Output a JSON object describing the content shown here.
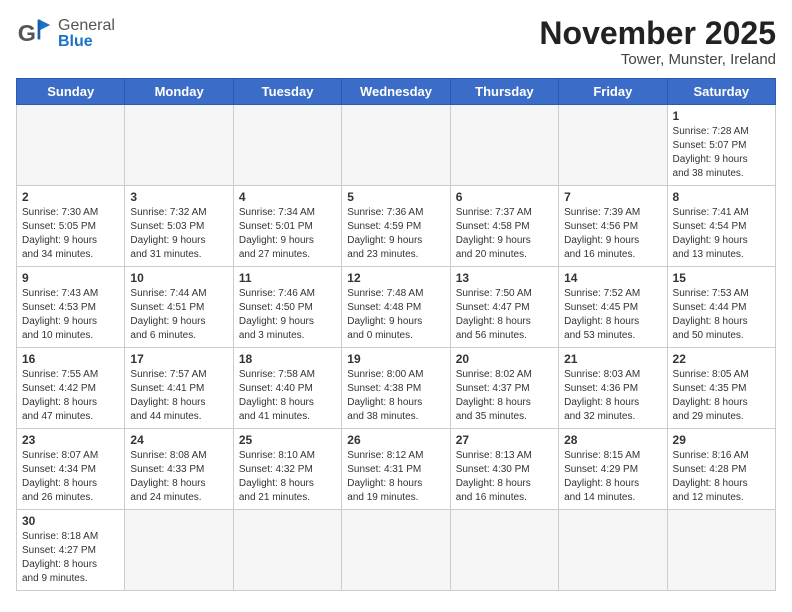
{
  "header": {
    "logo_text_general": "General",
    "logo_text_blue": "Blue",
    "title": "November 2025",
    "subtitle": "Tower, Munster, Ireland"
  },
  "weekdays": [
    "Sunday",
    "Monday",
    "Tuesday",
    "Wednesday",
    "Thursday",
    "Friday",
    "Saturday"
  ],
  "weeks": [
    [
      {
        "day": "",
        "info": ""
      },
      {
        "day": "",
        "info": ""
      },
      {
        "day": "",
        "info": ""
      },
      {
        "day": "",
        "info": ""
      },
      {
        "day": "",
        "info": ""
      },
      {
        "day": "",
        "info": ""
      },
      {
        "day": "1",
        "info": "Sunrise: 7:28 AM\nSunset: 5:07 PM\nDaylight: 9 hours\nand 38 minutes."
      }
    ],
    [
      {
        "day": "2",
        "info": "Sunrise: 7:30 AM\nSunset: 5:05 PM\nDaylight: 9 hours\nand 34 minutes."
      },
      {
        "day": "3",
        "info": "Sunrise: 7:32 AM\nSunset: 5:03 PM\nDaylight: 9 hours\nand 31 minutes."
      },
      {
        "day": "4",
        "info": "Sunrise: 7:34 AM\nSunset: 5:01 PM\nDaylight: 9 hours\nand 27 minutes."
      },
      {
        "day": "5",
        "info": "Sunrise: 7:36 AM\nSunset: 4:59 PM\nDaylight: 9 hours\nand 23 minutes."
      },
      {
        "day": "6",
        "info": "Sunrise: 7:37 AM\nSunset: 4:58 PM\nDaylight: 9 hours\nand 20 minutes."
      },
      {
        "day": "7",
        "info": "Sunrise: 7:39 AM\nSunset: 4:56 PM\nDaylight: 9 hours\nand 16 minutes."
      },
      {
        "day": "8",
        "info": "Sunrise: 7:41 AM\nSunset: 4:54 PM\nDaylight: 9 hours\nand 13 minutes."
      }
    ],
    [
      {
        "day": "9",
        "info": "Sunrise: 7:43 AM\nSunset: 4:53 PM\nDaylight: 9 hours\nand 10 minutes."
      },
      {
        "day": "10",
        "info": "Sunrise: 7:44 AM\nSunset: 4:51 PM\nDaylight: 9 hours\nand 6 minutes."
      },
      {
        "day": "11",
        "info": "Sunrise: 7:46 AM\nSunset: 4:50 PM\nDaylight: 9 hours\nand 3 minutes."
      },
      {
        "day": "12",
        "info": "Sunrise: 7:48 AM\nSunset: 4:48 PM\nDaylight: 9 hours\nand 0 minutes."
      },
      {
        "day": "13",
        "info": "Sunrise: 7:50 AM\nSunset: 4:47 PM\nDaylight: 8 hours\nand 56 minutes."
      },
      {
        "day": "14",
        "info": "Sunrise: 7:52 AM\nSunset: 4:45 PM\nDaylight: 8 hours\nand 53 minutes."
      },
      {
        "day": "15",
        "info": "Sunrise: 7:53 AM\nSunset: 4:44 PM\nDaylight: 8 hours\nand 50 minutes."
      }
    ],
    [
      {
        "day": "16",
        "info": "Sunrise: 7:55 AM\nSunset: 4:42 PM\nDaylight: 8 hours\nand 47 minutes."
      },
      {
        "day": "17",
        "info": "Sunrise: 7:57 AM\nSunset: 4:41 PM\nDaylight: 8 hours\nand 44 minutes."
      },
      {
        "day": "18",
        "info": "Sunrise: 7:58 AM\nSunset: 4:40 PM\nDaylight: 8 hours\nand 41 minutes."
      },
      {
        "day": "19",
        "info": "Sunrise: 8:00 AM\nSunset: 4:38 PM\nDaylight: 8 hours\nand 38 minutes."
      },
      {
        "day": "20",
        "info": "Sunrise: 8:02 AM\nSunset: 4:37 PM\nDaylight: 8 hours\nand 35 minutes."
      },
      {
        "day": "21",
        "info": "Sunrise: 8:03 AM\nSunset: 4:36 PM\nDaylight: 8 hours\nand 32 minutes."
      },
      {
        "day": "22",
        "info": "Sunrise: 8:05 AM\nSunset: 4:35 PM\nDaylight: 8 hours\nand 29 minutes."
      }
    ],
    [
      {
        "day": "23",
        "info": "Sunrise: 8:07 AM\nSunset: 4:34 PM\nDaylight: 8 hours\nand 26 minutes."
      },
      {
        "day": "24",
        "info": "Sunrise: 8:08 AM\nSunset: 4:33 PM\nDaylight: 8 hours\nand 24 minutes."
      },
      {
        "day": "25",
        "info": "Sunrise: 8:10 AM\nSunset: 4:32 PM\nDaylight: 8 hours\nand 21 minutes."
      },
      {
        "day": "26",
        "info": "Sunrise: 8:12 AM\nSunset: 4:31 PM\nDaylight: 8 hours\nand 19 minutes."
      },
      {
        "day": "27",
        "info": "Sunrise: 8:13 AM\nSunset: 4:30 PM\nDaylight: 8 hours\nand 16 minutes."
      },
      {
        "day": "28",
        "info": "Sunrise: 8:15 AM\nSunset: 4:29 PM\nDaylight: 8 hours\nand 14 minutes."
      },
      {
        "day": "29",
        "info": "Sunrise: 8:16 AM\nSunset: 4:28 PM\nDaylight: 8 hours\nand 12 minutes."
      }
    ],
    [
      {
        "day": "30",
        "info": "Sunrise: 8:18 AM\nSunset: 4:27 PM\nDaylight: 8 hours\nand 9 minutes."
      },
      {
        "day": "",
        "info": ""
      },
      {
        "day": "",
        "info": ""
      },
      {
        "day": "",
        "info": ""
      },
      {
        "day": "",
        "info": ""
      },
      {
        "day": "",
        "info": ""
      },
      {
        "day": "",
        "info": ""
      }
    ]
  ]
}
